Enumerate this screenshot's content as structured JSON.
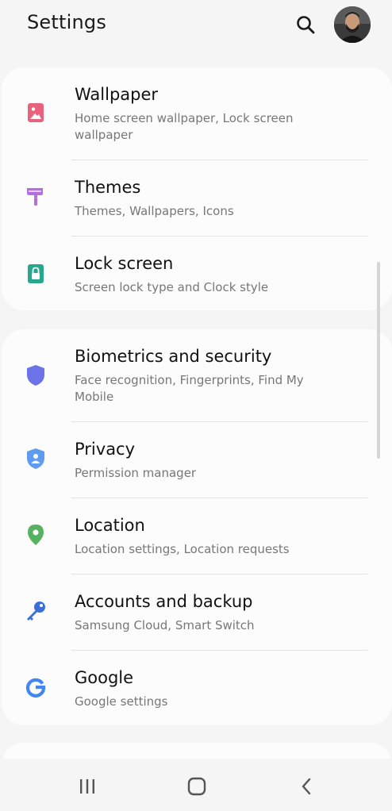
{
  "header": {
    "title": "Settings",
    "search_icon": "search-icon",
    "avatar": "user-profile-photo"
  },
  "groups": [
    {
      "items": [
        {
          "label": "Wallpaper",
          "subtitle": "Home screen wallpaper, Lock screen wallpaper",
          "icon": "wallpaper-icon",
          "color": "#e8627d"
        },
        {
          "label": "Themes",
          "subtitle": "Themes, Wallpapers, Icons",
          "icon": "themes-brush-icon",
          "color": "#b36fdc"
        },
        {
          "label": "Lock screen",
          "subtitle": "Screen lock type and Clock style",
          "icon": "lock-icon",
          "color": "#27a88d"
        }
      ]
    },
    {
      "items": [
        {
          "label": "Biometrics and security",
          "subtitle": "Face recognition, Fingerprints, Find My Mobile",
          "icon": "shield-icon",
          "color": "#6c72e8"
        },
        {
          "label": "Privacy",
          "subtitle": "Permission manager",
          "icon": "privacy-shield-icon",
          "color": "#5f9cf0"
        },
        {
          "label": "Location",
          "subtitle": "Location settings, Location requests",
          "icon": "location-pin-icon",
          "color": "#56b260"
        },
        {
          "label": "Accounts and backup",
          "subtitle": "Samsung Cloud, Smart Switch",
          "icon": "key-icon",
          "color": "#3a6fd8"
        },
        {
          "label": "Google",
          "subtitle": "Google settings",
          "icon": "google-icon",
          "color": "#4285f4"
        }
      ]
    }
  ],
  "navbar": {
    "recents_icon": "recent-apps-icon",
    "home_icon": "home-icon",
    "back_icon": "back-icon"
  }
}
